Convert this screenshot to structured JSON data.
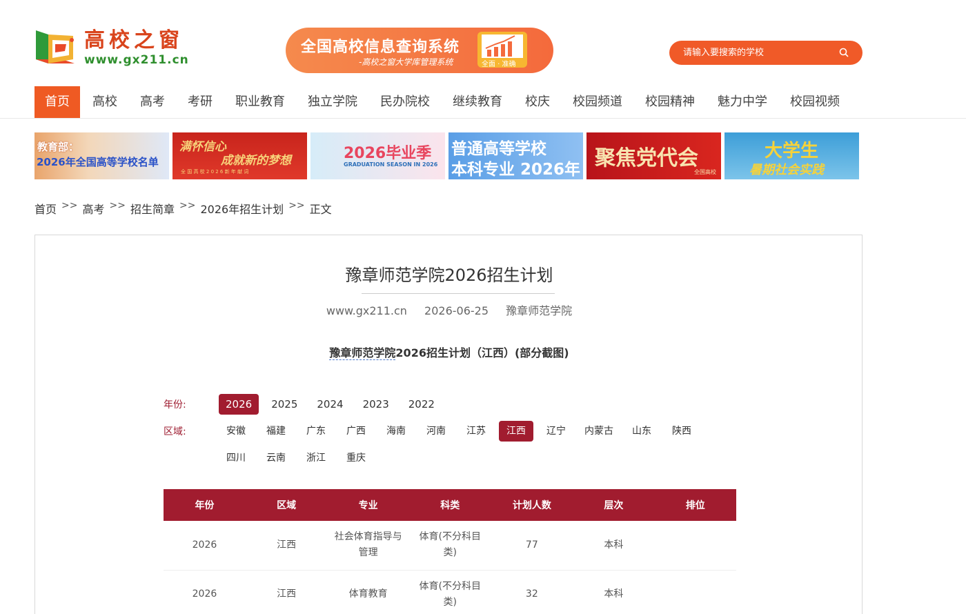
{
  "header": {
    "logo_cn": "高校之窗",
    "logo_url": "www.gx211.cn",
    "banner_title": "全国高校信息查询系统",
    "banner_sub": "-高校之窗大学库管理系统",
    "banner_tag": "全面 · 准确",
    "search_placeholder": "请输入要搜索的学校"
  },
  "nav": [
    {
      "label": "首页",
      "active": true
    },
    {
      "label": "高校"
    },
    {
      "label": "高考"
    },
    {
      "label": "考研"
    },
    {
      "label": "职业教育"
    },
    {
      "label": "独立学院"
    },
    {
      "label": "民办院校"
    },
    {
      "label": "继续教育"
    },
    {
      "label": "校庆"
    },
    {
      "label": "校园频道"
    },
    {
      "label": "校园精神"
    },
    {
      "label": "魅力中学"
    },
    {
      "label": "校园视频"
    }
  ],
  "promos": [
    {
      "line1": "教育部：",
      "line2": "2026年全国高等学校名单"
    },
    {
      "line1": "满怀信心",
      "line2": "成就新的梦想",
      "line3": "全 国 高 校 2 0 2 6 新 年 献 词"
    },
    {
      "line1": "2026毕业季",
      "line2": "GRADUATION SEASON IN 2026"
    },
    {
      "line1": "普通高等学校",
      "line2": "本科专业 2026年"
    },
    {
      "line1": "聚焦党代会",
      "line2": "全国高校"
    },
    {
      "line1": "大学生",
      "line2": "暑期社会实践"
    }
  ],
  "breadcrumb": [
    "首页",
    "高考",
    "招生简章",
    "2026年招生计划",
    "正文"
  ],
  "breadcrumb_sep": ">>",
  "article": {
    "title": "豫章师范学院2026招生计划",
    "source": "www.gx211.cn",
    "date": "2026-06-25",
    "author": "豫章师范学院",
    "sub_school": "豫章师范学院",
    "sub_rest": "2026招生计划（江西）(部分截图)"
  },
  "filters": {
    "year_label": "年份:",
    "years": [
      "2026",
      "2025",
      "2024",
      "2023",
      "2022"
    ],
    "year_selected": "2026",
    "region_label": "区域:",
    "regions_row1": [
      "安徽",
      "福建",
      "广东",
      "广西",
      "海南",
      "河南",
      "江苏",
      "江西",
      "辽宁",
      "内蒙古",
      "山东",
      "陕西"
    ],
    "regions_row2": [
      "四川",
      "云南",
      "浙江",
      "重庆"
    ],
    "region_selected": "江西"
  },
  "table": {
    "headers": [
      "年份",
      "区域",
      "专业",
      "科类",
      "计划人数",
      "层次",
      "排位"
    ],
    "rows": [
      [
        "2026",
        "江西",
        "社会体育指导与管理",
        "体育(不分科目类)",
        "77",
        "本科",
        ""
      ],
      [
        "2026",
        "江西",
        "体育教育",
        "体育(不分科目类)",
        "32",
        "本科",
        ""
      ]
    ]
  }
}
